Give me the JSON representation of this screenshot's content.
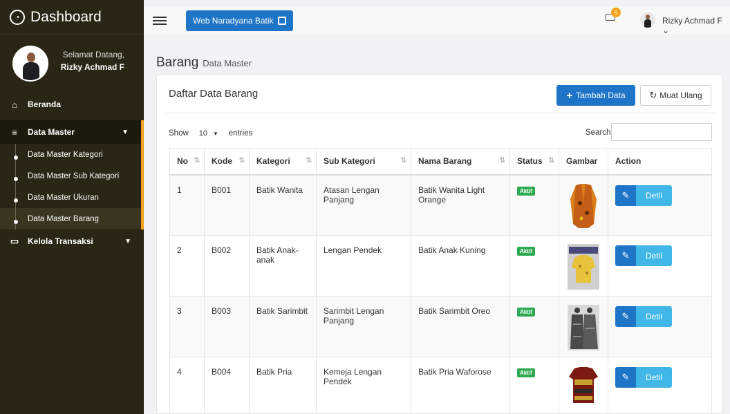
{
  "brand": {
    "title": "Dashboard"
  },
  "profile": {
    "welcome": "Selamat Datang,",
    "name": "Rizky Achmad F"
  },
  "menu": {
    "beranda": "Beranda",
    "data_master": "Data Master",
    "sub_items": [
      "Data Master Kategori",
      "Data Master Sub Kategori",
      "Data Master Ukuran",
      "Data Master Barang"
    ],
    "transaksi": "Kelola Transaksi"
  },
  "topbar": {
    "web_button": "Web Naradyana Batik",
    "badge_count": "6",
    "user": "Rizky Achmad F"
  },
  "page": {
    "title": "Barang",
    "subtitle": "Data Master"
  },
  "panel": {
    "title": "Daftar Data Barang",
    "add_button": "Tambah Data",
    "reload_button": "Muat Ulang",
    "show_label": "Show",
    "entries_value": "10",
    "entries_label": "entries",
    "search_label": "Search:"
  },
  "table": {
    "headers": [
      "No",
      "Kode",
      "Kategori",
      "Sub Kategori",
      "Nama Barang",
      "Status",
      "Gambar",
      "Action"
    ],
    "rows": [
      {
        "no": "1",
        "kode": "B001",
        "kategori": "Batik Wanita",
        "sub": "Atasan Lengan Panjang",
        "nama": "Batik Wanita Light Orange",
        "status": "Aktif",
        "action": "Detil"
      },
      {
        "no": "2",
        "kode": "B002",
        "kategori": "Batik Anak-anak",
        "sub": "Lengan Pendek",
        "nama": "Batik Anak Kuning",
        "status": "Aktif",
        "action": "Detil"
      },
      {
        "no": "3",
        "kode": "B003",
        "kategori": "Batik Sarimbit",
        "sub": "Sarimbit Lengan Panjang",
        "nama": "Batik Sarimbit Oreo",
        "status": "Aktif",
        "action": "Detil"
      },
      {
        "no": "4",
        "kode": "B004",
        "kategori": "Batik Pria",
        "sub": "Kemeja Lengan Pendek",
        "nama": "Batik Pria Waforose",
        "status": "Aktif",
        "action": "Detil"
      }
    ]
  },
  "colors": {
    "sidebar": "#2a2514",
    "accent": "#f2a31b",
    "primary": "#1e74c6",
    "info": "#41b7e8",
    "success": "#2eaa52"
  }
}
